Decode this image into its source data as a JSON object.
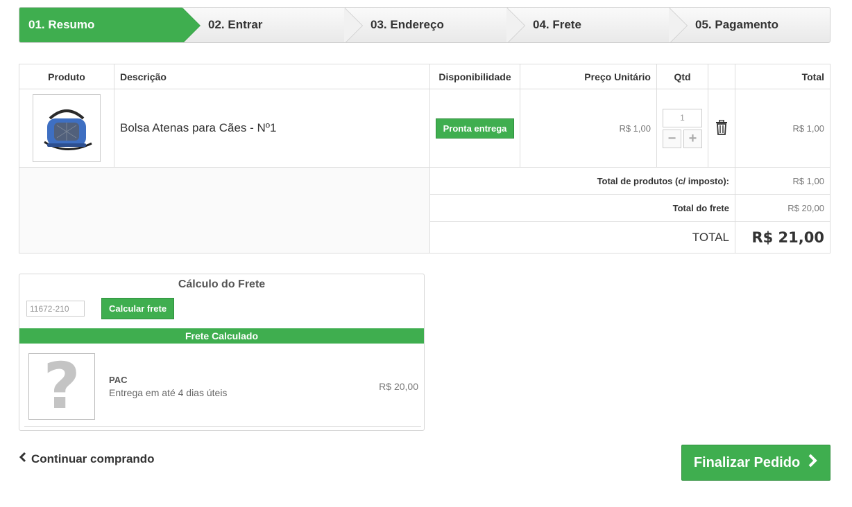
{
  "steps": [
    {
      "label": "01. Resumo"
    },
    {
      "label": "02. Entrar"
    },
    {
      "label": "03. Endereço"
    },
    {
      "label": "04. Frete"
    },
    {
      "label": "05. Pagamento"
    }
  ],
  "cart": {
    "headers": {
      "product": "Produto",
      "description": "Descrição",
      "availability": "Disponibilidade",
      "unit_price": "Preço Unitário",
      "qty": "Qtd",
      "total": "Total"
    },
    "items": [
      {
        "description": "Bolsa Atenas para Cães - Nº1",
        "availability": "Pronta entrega",
        "unit_price": "R$ 1,00",
        "qty": "1",
        "total": "R$ 1,00"
      }
    ],
    "summary": {
      "products_label": "Total de produtos (c/ imposto):",
      "products_value": "R$ 1,00",
      "shipping_label": "Total do frete",
      "shipping_value": "R$ 20,00",
      "grand_label": "TOTAL",
      "grand_value": "R$ 21,00"
    }
  },
  "shipping_calc": {
    "title": "Cálculo do Frete",
    "cep_value": "11672-210",
    "calc_button": "Calcular frete",
    "bar_label": "Frete Calculado",
    "option": {
      "name": "PAC",
      "description": "Entrega em até 4 dias úteis",
      "price": "R$ 20,00"
    }
  },
  "footer": {
    "continue_label": "Continuar comprando",
    "finalize_label": "Finalizar Pedido"
  },
  "colors": {
    "accent_green": "#3fae4f"
  },
  "icons": {
    "delete": "trash-icon",
    "continue": "chevron-left-icon",
    "finalize": "chevron-right-icon",
    "placeholder": "question-mark-icon"
  }
}
